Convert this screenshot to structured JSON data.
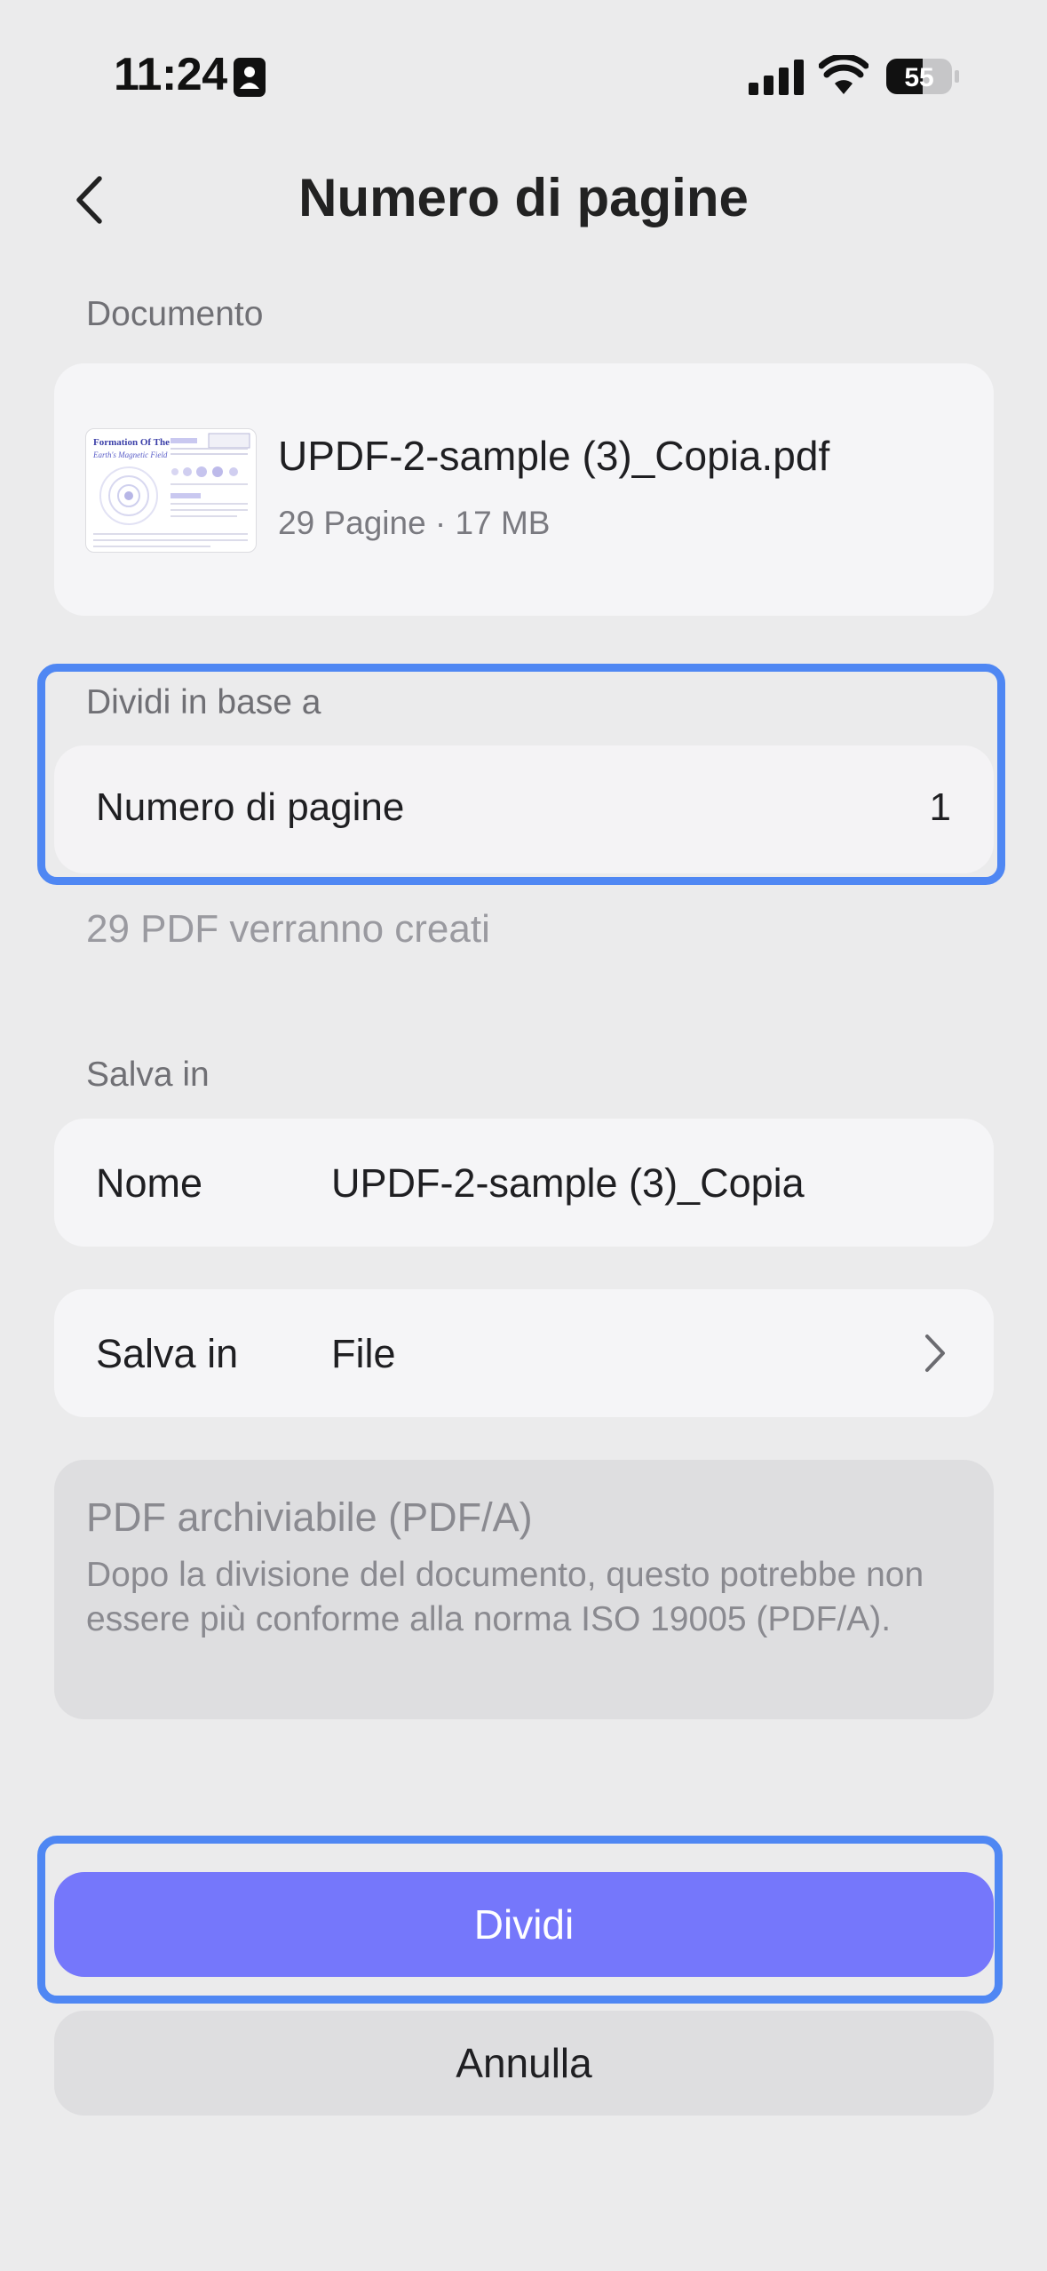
{
  "status_bar": {
    "time": "11:24",
    "battery": "55",
    "icons": [
      "person-badge-icon",
      "signal-icon",
      "wifi-icon",
      "battery-icon"
    ]
  },
  "header": {
    "title": "Numero di pagine",
    "back_icon": "chevron-left-icon"
  },
  "document": {
    "section_label": "Documento",
    "file_name": "UPDF-2-sample (3)_Copia.pdf",
    "meta": "29 Pagine · 17 MB",
    "thumbnail": {
      "title_line1": "Formation Of The",
      "title_line2": "Earth's Magnetic Field"
    }
  },
  "split": {
    "section_label": "Dividi in base a",
    "option_label": "Numero di pagine",
    "option_value": "1",
    "result_text": "29 PDF verranno creati"
  },
  "save": {
    "section_label": "Salva in",
    "name_label": "Nome",
    "name_value": "UPDF-2-sample (3)_Copia",
    "location_label": "Salva in",
    "location_value": "File"
  },
  "pdfa": {
    "title": "PDF archiviabile (PDF/A)",
    "description": "Dopo la divisione del documento, questo potrebbe non essere più conforme alla norma ISO 19005 (PDF/A)."
  },
  "actions": {
    "primary": "Dividi",
    "secondary": "Annulla"
  },
  "colors": {
    "accent": "#7577fb",
    "highlight": "#4f87f3",
    "background": "#ebebec"
  }
}
